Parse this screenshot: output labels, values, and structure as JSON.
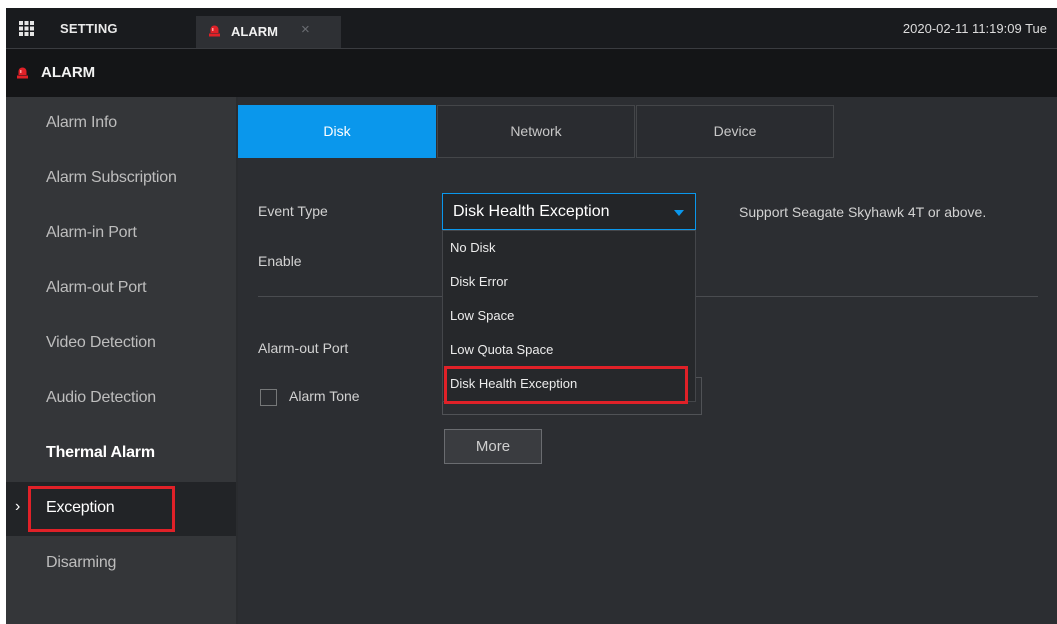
{
  "topbar": {
    "setting_label": "SETTING",
    "alarm_tab_label": "ALARM",
    "close_glyph": "×",
    "datetime": "2020-02-11 11:19:09 Tue"
  },
  "module": {
    "title": "ALARM"
  },
  "sidebar": {
    "arrow": "›",
    "items": [
      {
        "label": "Alarm Info"
      },
      {
        "label": "Alarm Subscription"
      },
      {
        "label": "Alarm-in Port"
      },
      {
        "label": "Alarm-out Port"
      },
      {
        "label": "Video Detection"
      },
      {
        "label": "Audio Detection"
      },
      {
        "label": "Thermal Alarm"
      },
      {
        "label": "Exception"
      },
      {
        "label": "Disarming"
      }
    ],
    "active_item": "Exception"
  },
  "tabs": [
    {
      "label": "Disk"
    },
    {
      "label": "Network"
    },
    {
      "label": "Device"
    }
  ],
  "form": {
    "event_type_label": "Event Type",
    "event_type_value": "Disk Health Exception",
    "support_note": "Support Seagate Skyhawk 4T or above.",
    "enable_label": "Enable",
    "alarm_out_label": "Alarm-out Port",
    "alarm_tone_label": "Alarm Tone",
    "more_button": "More"
  },
  "dropdown": {
    "options": [
      {
        "label": "No Disk"
      },
      {
        "label": "Disk Error"
      },
      {
        "label": "Low Space"
      },
      {
        "label": "Low Quota Space"
      },
      {
        "label": "Disk Health Exception"
      }
    ],
    "selected": "Disk Health Exception"
  },
  "colors": {
    "accent": "#0a97ec",
    "highlight": "#e02128",
    "siren": "#e02128"
  }
}
